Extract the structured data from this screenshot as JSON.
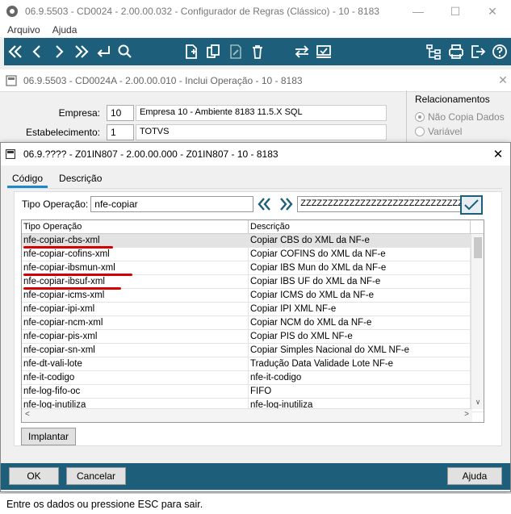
{
  "main_window": {
    "title": "06.9.5503 - CD0024 - 2.00.00.032 - Configurador de Regras (Clássico) - 10 - 8183",
    "menu": [
      "Arquivo",
      "Ajuda"
    ]
  },
  "sub_window": {
    "title": "06.9.5503 - CD0024A - 2.00.00.010 - Inclui Operação - 10 - 8183",
    "empresa_label": "Empresa:",
    "empresa_value": "10",
    "empresa_desc": "Empresa 10 - Ambiente 8183 11.5.X SQL",
    "estab_label": "Estabelecimento:",
    "estab_value": "1",
    "estab_desc": "TOTVS",
    "relacionamentos_label": "Relacionamentos",
    "radio_nao_copia": "Não Copia Dados",
    "radio_variavel": "Variável"
  },
  "dialog": {
    "title": "06.9.???? - Z01IN807 - 2.00.00.000 - Z01IN807 - 10 - 8183",
    "tabs": [
      "Código",
      "Descrição"
    ],
    "search_label": "Tipo Operação:",
    "search_value": "nfe-copiar",
    "range_end_value": "ZZZZZZZZZZZZZZZZZZZZZZZZZZZZZZZZZZZZ",
    "grid": {
      "headers": [
        "Tipo Operação",
        "Descrição"
      ],
      "rows": [
        [
          "nfe-copiar-cbs-xml",
          "Copiar CBS do XML da NF-e"
        ],
        [
          "nfe-copiar-cofins-xml",
          "Copiar COFINS do XML da NF-e"
        ],
        [
          "nfe-copiar-ibsmun-xml",
          "Copiar IBS Mun do XML da NF-e"
        ],
        [
          "nfe-copiar-ibsuf-xml",
          "Copiar IBS UF do XML da NF-e"
        ],
        [
          "nfe-copiar-icms-xml",
          "Copiar ICMS do XML da NF-e"
        ],
        [
          "nfe-copiar-ipi-xml",
          "Copiar IPI XML NF-e"
        ],
        [
          "nfe-copiar-ncm-xml",
          "Copiar NCM do XML da NF-e"
        ],
        [
          "nfe-copiar-pis-xml",
          "Copiar PIS do XML NF-e"
        ],
        [
          "nfe-copiar-sn-xml",
          "Copiar Simples Nacional do XML NF-e"
        ],
        [
          "nfe-dt-vali-lote",
          "Tradução Data Validade Lote NF-e"
        ],
        [
          "nfe-it-codigo",
          "nfe-it-codigo"
        ],
        [
          "nfe-log-fifo-oc",
          "FIFO"
        ],
        [
          "nfe-log-inutiliza",
          "nfe-log-inutiliza"
        ]
      ]
    },
    "implantar_label": "Implantar",
    "ok_label": "OK",
    "cancelar_label": "Cancelar",
    "ajuda_label": "Ajuda"
  },
  "status_text": "Entre os dados ou pressione ESC para sair.",
  "colors": {
    "toolbar": "#1d5e7a",
    "highlight_underline": "#d40000",
    "tab_accent": "#1e88c8"
  }
}
